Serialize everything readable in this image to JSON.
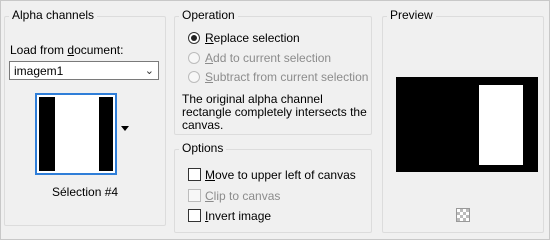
{
  "alpha": {
    "title": "Alpha channels",
    "load_label_pre": "Load from ",
    "load_label_u": "d",
    "load_label_post": "ocument:",
    "document_value": "imagem1",
    "selection_caption": "Sélection #4"
  },
  "operation": {
    "title": "Operation",
    "options": [
      {
        "pre": "",
        "u": "R",
        "post": "eplace selection",
        "checked": true,
        "enabled": true
      },
      {
        "pre": "",
        "u": "A",
        "post": "dd to current selection",
        "checked": false,
        "enabled": false
      },
      {
        "pre": "",
        "u": "S",
        "post": "ubtract from current selection",
        "checked": false,
        "enabled": false
      }
    ],
    "info_line1": "The original alpha channel",
    "info_line2": "rectangle completely intersects the",
    "info_line3": "canvas."
  },
  "options": {
    "title": "Options",
    "items": [
      {
        "pre": "",
        "u": "M",
        "post": "ove to upper left of canvas",
        "checked": false,
        "enabled": true
      },
      {
        "pre": "",
        "u": "C",
        "post": "lip to canvas",
        "checked": false,
        "enabled": false
      },
      {
        "pre": "",
        "u": "I",
        "post": "nvert image",
        "checked": false,
        "enabled": true
      }
    ]
  },
  "preview": {
    "title": "Preview"
  }
}
